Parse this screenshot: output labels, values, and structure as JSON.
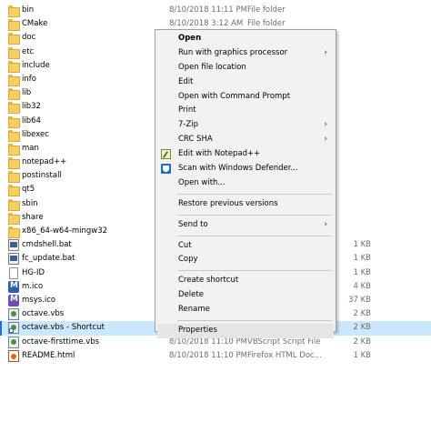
{
  "files": [
    {
      "name": "bin",
      "date": "8/10/2018 11:11 PM",
      "type": "File folder",
      "size": "",
      "icon": "folder-icon"
    },
    {
      "name": "CMake",
      "date": "8/10/2018 3:12 AM",
      "type": "File folder",
      "size": "",
      "icon": "folder-icon"
    },
    {
      "name": "doc",
      "date": "",
      "type": "",
      "size": "",
      "icon": "folder-icon"
    },
    {
      "name": "etc",
      "date": "",
      "type": "",
      "size": "",
      "icon": "folder-icon"
    },
    {
      "name": "include",
      "date": "",
      "type": "",
      "size": "",
      "icon": "folder-icon"
    },
    {
      "name": "info",
      "date": "",
      "type": "",
      "size": "",
      "icon": "folder-icon"
    },
    {
      "name": "lib",
      "date": "",
      "type": "",
      "size": "",
      "icon": "folder-icon"
    },
    {
      "name": "lib32",
      "date": "",
      "type": "",
      "size": "",
      "icon": "folder-icon"
    },
    {
      "name": "lib64",
      "date": "",
      "type": "",
      "size": "",
      "icon": "folder-icon"
    },
    {
      "name": "libexec",
      "date": "",
      "type": "",
      "size": "",
      "icon": "folder-icon"
    },
    {
      "name": "man",
      "date": "",
      "type": "",
      "size": "",
      "icon": "folder-icon"
    },
    {
      "name": "notepad++",
      "date": "",
      "type": "",
      "size": "",
      "icon": "folder-icon"
    },
    {
      "name": "postinstall",
      "date": "",
      "type": "",
      "size": "",
      "icon": "folder-icon"
    },
    {
      "name": "qt5",
      "date": "",
      "type": "",
      "size": "",
      "icon": "folder-icon"
    },
    {
      "name": "sbin",
      "date": "",
      "type": "",
      "size": "",
      "icon": "folder-icon"
    },
    {
      "name": "share",
      "date": "",
      "type": "",
      "size": "",
      "icon": "folder-icon"
    },
    {
      "name": "x86_64-w64-mingw32",
      "date": "",
      "type": "",
      "size": "",
      "icon": "folder-icon"
    },
    {
      "name": "cmdshell.bat",
      "date": "",
      "type": "",
      "size": "1 KB",
      "icon": "batch-file-icon"
    },
    {
      "name": "fc_update.bat",
      "date": "",
      "type": "",
      "size": "1 KB",
      "icon": "batch-file-icon"
    },
    {
      "name": "HG-ID",
      "date": "",
      "type": "",
      "size": "1 KB",
      "icon": "file-icon"
    },
    {
      "name": "m.ico",
      "date": "",
      "type": "",
      "size": "4 KB",
      "icon": "ico-file-icon"
    },
    {
      "name": "msys.ico",
      "date": "",
      "type": "",
      "size": "37 KB",
      "icon": "ico-file-icon-alt"
    },
    {
      "name": "octave.vbs",
      "date": "",
      "type": "",
      "size": "2 KB",
      "icon": "vbs-file-icon"
    },
    {
      "name": "octave.vbs - Shortcut",
      "date": "",
      "type": "",
      "size": "2 KB",
      "icon": "shortcut-file-icon"
    },
    {
      "name": "octave-firsttime.vbs",
      "date": "8/10/2018 11:10 PM",
      "type": "VBScript Script File",
      "size": "2 KB",
      "icon": "vbs-file-icon"
    },
    {
      "name": "README.html",
      "date": "8/10/2018 11:10 PM",
      "type": "Firefox HTML Doc...",
      "size": "1 KB",
      "icon": "html-file-icon"
    }
  ],
  "highlighted_index": 23,
  "context_menu": {
    "groups": [
      [
        {
          "label": "Open",
          "bold": true
        },
        {
          "label": "Run with graphics processor",
          "submenu": true
        },
        {
          "label": "Open file location"
        },
        {
          "label": "Edit"
        },
        {
          "label": "Open with Command Prompt"
        },
        {
          "label": "Print"
        },
        {
          "label": "7-Zip",
          "submenu": true
        },
        {
          "label": "CRC SHA",
          "submenu": true
        },
        {
          "label": "Edit with Notepad++",
          "icon": "notepad-plus-plus-icon"
        },
        {
          "label": "Scan with Windows Defender...",
          "icon": "windows-defender-icon"
        },
        {
          "label": "Open with..."
        }
      ],
      [
        {
          "label": "Restore previous versions"
        }
      ],
      [
        {
          "label": "Send to",
          "submenu": true
        }
      ],
      [
        {
          "label": "Cut"
        },
        {
          "label": "Copy"
        }
      ],
      [
        {
          "label": "Create shortcut"
        },
        {
          "label": "Delete"
        },
        {
          "label": "Rename"
        }
      ],
      [
        {
          "label": "Properties",
          "hovered": true
        }
      ]
    ],
    "submenu_arrow": "›"
  }
}
